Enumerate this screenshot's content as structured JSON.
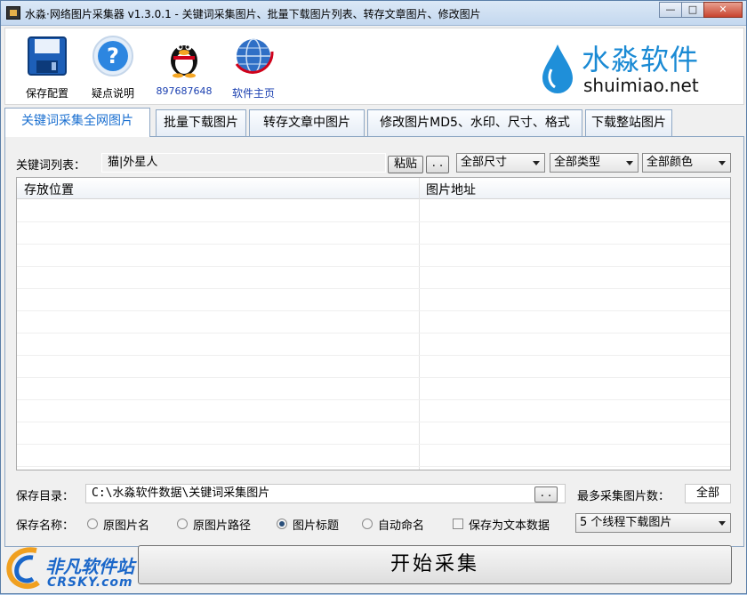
{
  "window": {
    "title": "水淼·网络图片采集器 v1.3.0.1 - 关键词采集图片、批量下载图片列表、转存文章图片、修改图片",
    "minimize": "—",
    "maximize": "□",
    "close": "✕"
  },
  "toolbar": {
    "items": [
      {
        "label": "保存配置",
        "icon": "floppy-disk-icon"
      },
      {
        "label": "疑点说明",
        "icon": "help-icon"
      },
      {
        "label": "897687648",
        "icon": "qq-penguin-icon"
      },
      {
        "label": "软件主页",
        "icon": "globe-icon"
      }
    ],
    "brand_cn": "水淼软件",
    "brand_en": "shuimiao.net"
  },
  "tabs": [
    {
      "label": "关键词采集全网图片",
      "active": true
    },
    {
      "label": "批量下载图片",
      "active": false
    },
    {
      "label": "转存文章中图片",
      "active": false
    },
    {
      "label": "修改图片MD5、水印、尺寸、格式",
      "active": false
    },
    {
      "label": "下载整站图片",
      "active": false
    }
  ],
  "keywords": {
    "label": "关键词列表：",
    "value": "猫|外星人",
    "paste_button": "粘贴",
    "browse_button": ". ."
  },
  "filters": {
    "size": "全部尺寸",
    "type": "全部类型",
    "color": "全部颜色"
  },
  "table": {
    "columns": [
      "存放位置",
      "图片地址"
    ],
    "rows": []
  },
  "save_dir": {
    "label": "保存目录：",
    "value": "C:\\水淼软件数据\\关键词采集图片",
    "browse_button": ". .",
    "max_label": "最多采集图片数：",
    "max_value": "全部"
  },
  "save_name": {
    "label": "保存名称：",
    "options": [
      {
        "label": "原图片名",
        "checked": false
      },
      {
        "label": "原图片路径",
        "checked": false
      },
      {
        "label": "图片标题",
        "checked": true
      },
      {
        "label": "自动命名",
        "checked": false
      }
    ],
    "text_data_label": "保存为文本数据",
    "text_data_checked": false,
    "threads": "5 个线程下载图片"
  },
  "start_button": "开始采集",
  "watermark": {
    "line1": "非凡软件站",
    "line2": "CRSKY.com"
  },
  "colors": {
    "accent": "#1a6fd0",
    "brand": "#1a8ad4",
    "link": "#1a3fb0"
  }
}
